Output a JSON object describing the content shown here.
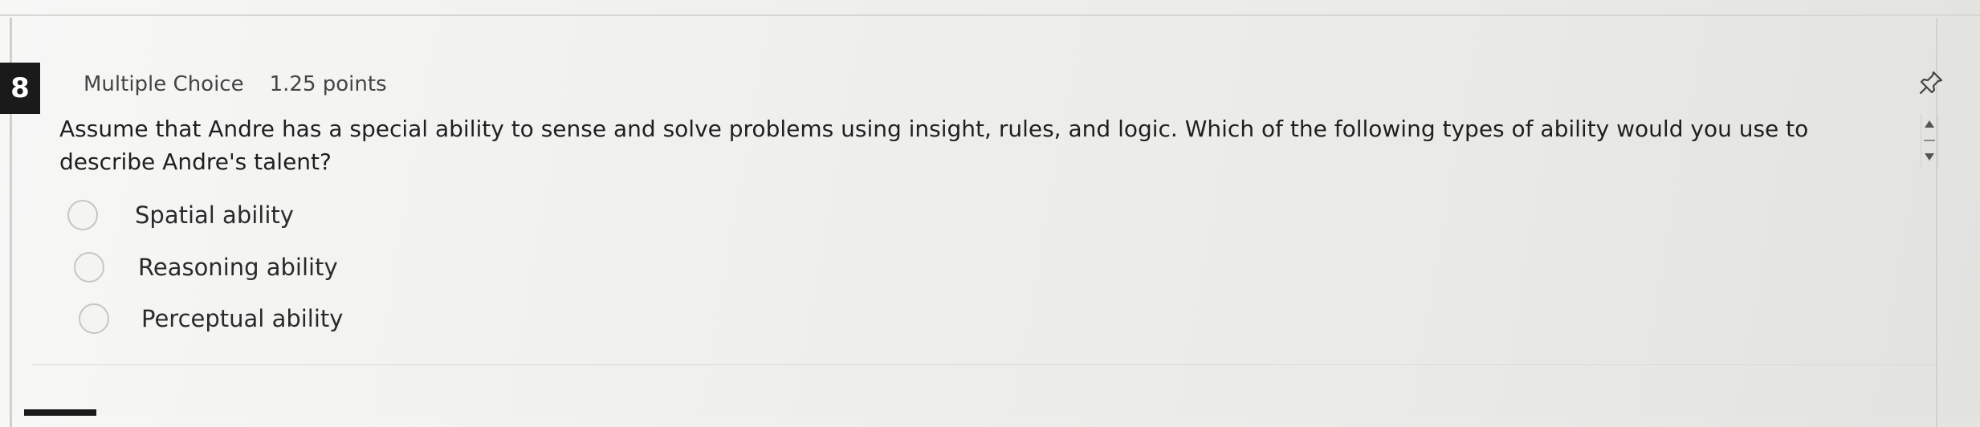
{
  "question": {
    "number": "8",
    "type": "Multiple Choice",
    "points": "1.25 points",
    "text": "Assume that Andre has a special ability to sense and solve problems using insight, rules, and logic. Which of the following types of ability would you use to describe Andre's talent?"
  },
  "options": [
    {
      "label": "Spatial ability",
      "selected": false
    },
    {
      "label": "Reasoning ability",
      "selected": false
    },
    {
      "label": "Perceptual ability",
      "selected": false
    }
  ],
  "icons": {
    "pin": "pin-icon",
    "scroll_up": "arrow-up-icon",
    "scroll_down": "arrow-down-icon",
    "radio": "radio-button-icon"
  },
  "colors": {
    "question_number_bg": "#1a1a1a",
    "question_number_fg": "#ffffff",
    "text": "#1f1f1f",
    "radio_border": "#c6c6c6"
  }
}
